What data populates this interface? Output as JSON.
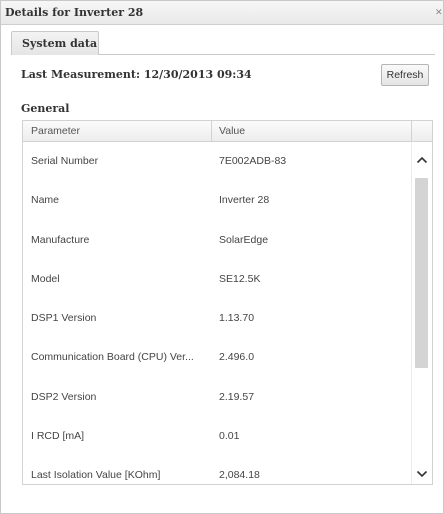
{
  "window": {
    "title": "Details for Inverter 28",
    "close_glyph": "✕"
  },
  "tabs": [
    {
      "label": "System data"
    }
  ],
  "measurement": {
    "text": "Last Measurement: 12/30/2013 09:34"
  },
  "toolbar": {
    "refresh_label": "Refresh"
  },
  "general": {
    "title": "General",
    "columns": [
      "Parameter",
      "Value"
    ],
    "rows": [
      {
        "param": "Serial Number",
        "value": "7E002ADB-83"
      },
      {
        "param": "Name",
        "value": "Inverter 28"
      },
      {
        "param": "Manufacture",
        "value": "SolarEdge"
      },
      {
        "param": "Model",
        "value": "SE12.5K"
      },
      {
        "param": "DSP1 Version",
        "value": "1.13.70"
      },
      {
        "param": "Communication Board (CPU) Ver...",
        "value": "2.496.0"
      },
      {
        "param": "DSP2 Version",
        "value": "2.19.57"
      },
      {
        "param": "I RCD [mA]",
        "value": "0.01"
      },
      {
        "param": "Last Isolation Value [KOhm]",
        "value": "2,084.18"
      }
    ]
  },
  "colors": {
    "border": "#c9c9c9",
    "text": "#444444",
    "scroll_thumb": "#d4d4d4"
  }
}
